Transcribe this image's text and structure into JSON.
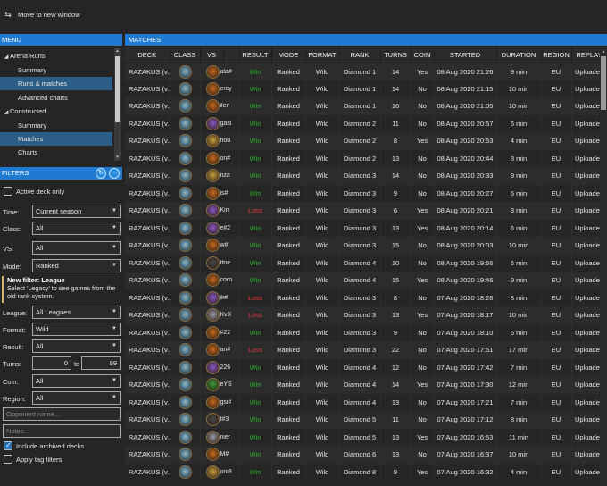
{
  "toolbar": {
    "move_label": "Move to new window",
    "move_icon": "swap-arrows-icon"
  },
  "menu": {
    "header": "MENU",
    "items": [
      {
        "label": "Arena Runs",
        "level": 0,
        "expander": "expanded"
      },
      {
        "label": "Summary",
        "level": 1
      },
      {
        "label": "Runs & matches",
        "level": 1,
        "selected": true
      },
      {
        "label": "Advanced charts",
        "level": 1
      },
      {
        "label": "Constructed",
        "level": 0,
        "expander": "expanded"
      },
      {
        "label": "Summary",
        "level": 1
      },
      {
        "label": "Matches",
        "level": 1,
        "selected": true
      },
      {
        "label": "Charts",
        "level": 1
      }
    ]
  },
  "filters": {
    "header": "FILTERS",
    "refresh_icon": "refresh-icon",
    "more_icon": "more-icon",
    "active_deck_only": {
      "label": "Active deck only",
      "checked": false
    },
    "time": {
      "label": "Time:",
      "value": "Current season"
    },
    "class": {
      "label": "Class:",
      "value": "All"
    },
    "vs": {
      "label": "VS:",
      "value": "All"
    },
    "mode": {
      "label": "Mode:",
      "value": "Ranked"
    },
    "notice": {
      "title": "New filter: League",
      "body": "Select 'Legacy' to see games from the old rank system."
    },
    "league": {
      "label": "League:",
      "value": "All Leagues"
    },
    "format": {
      "label": "Format:",
      "value": "Wild"
    },
    "result": {
      "label": "Result:",
      "value": "All"
    },
    "turns": {
      "label": "Turns:",
      "from": "0",
      "to_label": "to",
      "to": "99"
    },
    "coin": {
      "label": "Coin:",
      "value": "All"
    },
    "region": {
      "label": "Region:",
      "value": "All"
    },
    "opponent_placeholder": "Opponent name...",
    "notes_placeholder": "Notes...",
    "include_archived": {
      "label": "Include archived decks",
      "checked": true
    },
    "apply_tag": {
      "label": "Apply tag filters",
      "checked": false
    }
  },
  "matches": {
    "header": "MATCHES",
    "columns": [
      "DECK",
      "CLASS",
      "VS",
      "",
      "RESULT",
      "MODE",
      "FORMAT",
      "RANK",
      "TURNS",
      "COIN",
      "STARTED",
      "DURATION",
      "REGION",
      "REPLAY"
    ],
    "rows": [
      {
        "deck": "RAZAKUS (v...",
        "vs": "ala#",
        "vs_color": "#c96a1e",
        "result": "Win",
        "mode": "Ranked",
        "format": "Wild",
        "rank": "Diamond 1",
        "turns": "14",
        "coin": "Yes",
        "started": "08 Aug 2020 21:26",
        "duration": "9 min",
        "region": "EU",
        "replay": "Uploaded"
      },
      {
        "deck": "RAZAKUS (v...",
        "vs": "ercy",
        "vs_color": "#c96a1e",
        "result": "Win",
        "mode": "Ranked",
        "format": "Wild",
        "rank": "Diamond 1",
        "turns": "14",
        "coin": "No",
        "started": "08 Aug 2020 21:15",
        "duration": "10 min",
        "region": "EU",
        "replay": "Uploaded"
      },
      {
        "deck": "RAZAKUS (v...",
        "vs": "ilen",
        "vs_color": "#c96a1e",
        "result": "Win",
        "mode": "Ranked",
        "format": "Wild",
        "rank": "Diamond 1",
        "turns": "16",
        "coin": "No",
        "started": "08 Aug 2020 21:05",
        "duration": "10 min",
        "region": "EU",
        "replay": "Uploaded"
      },
      {
        "deck": "RAZAKUS (v...",
        "vs": "gasi",
        "vs_color": "#8a58c8",
        "result": "Win",
        "mode": "Ranked",
        "format": "Wild",
        "rank": "Diamond 2",
        "turns": "11",
        "coin": "No",
        "started": "08 Aug 2020 20:57",
        "duration": "6 min",
        "region": "EU",
        "replay": "Uploaded"
      },
      {
        "deck": "RAZAKUS (v...",
        "vs": "hou",
        "vs_color": "#c8a040",
        "result": "Win",
        "mode": "Ranked",
        "format": "Wild",
        "rank": "Diamond 2",
        "turns": "8",
        "coin": "Yes",
        "started": "08 Aug 2020 20:53",
        "duration": "4 min",
        "region": "EU",
        "replay": "Uploaded"
      },
      {
        "deck": "RAZAKUS (v...",
        "vs": "on#",
        "vs_color": "#c96a1e",
        "result": "Win",
        "mode": "Ranked",
        "format": "Wild",
        "rank": "Diamond 2",
        "turns": "13",
        "coin": "No",
        "started": "08 Aug 2020 20:44",
        "duration": "8 min",
        "region": "EU",
        "replay": "Uploaded"
      },
      {
        "deck": "RAZAKUS (v...",
        "vs": "nza",
        "vs_color": "#c8a040",
        "result": "Win",
        "mode": "Ranked",
        "format": "Wild",
        "rank": "Diamond 3",
        "turns": "14",
        "coin": "No",
        "started": "08 Aug 2020 20:33",
        "duration": "9 min",
        "region": "EU",
        "replay": "Uploaded"
      },
      {
        "deck": "RAZAKUS (v...",
        "vs": "is#",
        "vs_color": "#c96a1e",
        "result": "Win",
        "mode": "Ranked",
        "format": "Wild",
        "rank": "Diamond 3",
        "turns": "9",
        "coin": "No",
        "started": "08 Aug 2020 20:27",
        "duration": "5 min",
        "region": "EU",
        "replay": "Uploaded"
      },
      {
        "deck": "RAZAKUS (v...",
        "vs": "Kin",
        "vs_color": "#8a58c8",
        "result": "Loss",
        "mode": "Ranked",
        "format": "Wild",
        "rank": "Diamond 3",
        "turns": "6",
        "coin": "Yes",
        "started": "08 Aug 2020 20:21",
        "duration": "3 min",
        "region": "EU",
        "replay": "Uploaded"
      },
      {
        "deck": "RAZAKUS (v...",
        "vs": "e#2",
        "vs_color": "#8a58c8",
        "result": "Win",
        "mode": "Ranked",
        "format": "Wild",
        "rank": "Diamond 3",
        "turns": "13",
        "coin": "Yes",
        "started": "08 Aug 2020 20:14",
        "duration": "6 min",
        "region": "EU",
        "replay": "Uploaded"
      },
      {
        "deck": "RAZAKUS (v...",
        "vs": "w#",
        "vs_color": "#c96a1e",
        "result": "Win",
        "mode": "Ranked",
        "format": "Wild",
        "rank": "Diamond 3",
        "turns": "15",
        "coin": "No",
        "started": "08 Aug 2020 20:03",
        "duration": "10 min",
        "region": "EU",
        "replay": "Uploaded"
      },
      {
        "deck": "RAZAKUS (v...",
        "vs": "ttne",
        "vs_color": "#4a4a4a",
        "result": "Win",
        "mode": "Ranked",
        "format": "Wild",
        "rank": "Diamond 4",
        "turns": "10",
        "coin": "No",
        "started": "08 Aug 2020 19:56",
        "duration": "6 min",
        "region": "EU",
        "replay": "Uploaded"
      },
      {
        "deck": "RAZAKUS (v...",
        "vs": "corn",
        "vs_color": "#c96a1e",
        "result": "Win",
        "mode": "Ranked",
        "format": "Wild",
        "rank": "Diamond 4",
        "turns": "15",
        "coin": "Yes",
        "started": "08 Aug 2020 19:46",
        "duration": "9 min",
        "region": "EU",
        "replay": "Uploaded"
      },
      {
        "deck": "RAZAKUS (v...",
        "vs": "ik#",
        "vs_color": "#8a58c8",
        "result": "Loss",
        "mode": "Ranked",
        "format": "Wild",
        "rank": "Diamond 3",
        "turns": "8",
        "coin": "No",
        "started": "07 Aug 2020 18:28",
        "duration": "8 min",
        "region": "EU",
        "replay": "Uploaded"
      },
      {
        "deck": "RAZAKUS (v...",
        "vs": "KvX",
        "vs_color": "#9a9aa8",
        "result": "Loss",
        "mode": "Ranked",
        "format": "Wild",
        "rank": "Diamond 3",
        "turns": "13",
        "coin": "Yes",
        "started": "07 Aug 2020 18:17",
        "duration": "10 min",
        "region": "EU",
        "replay": "Uploaded"
      },
      {
        "deck": "RAZAKUS (v...",
        "vs": "#22",
        "vs_color": "#c96a1e",
        "result": "Win",
        "mode": "Ranked",
        "format": "Wild",
        "rank": "Diamond 3",
        "turns": "9",
        "coin": "No",
        "started": "07 Aug 2020 18:10",
        "duration": "6 min",
        "region": "EU",
        "replay": "Uploaded"
      },
      {
        "deck": "RAZAKUS (v...",
        "vs": "an#",
        "vs_color": "#c96a1e",
        "result": "Loss",
        "mode": "Ranked",
        "format": "Wild",
        "rank": "Diamond 3",
        "turns": "22",
        "coin": "No",
        "started": "07 Aug 2020 17:51",
        "duration": "17 min",
        "region": "EU",
        "replay": "Uploaded"
      },
      {
        "deck": "RAZAKUS (v...",
        "vs": "226",
        "vs_color": "#8a58c8",
        "result": "Win",
        "mode": "Ranked",
        "format": "Wild",
        "rank": "Diamond 4",
        "turns": "12",
        "coin": "No",
        "started": "07 Aug 2020 17:42",
        "duration": "7 min",
        "region": "EU",
        "replay": "Uploaded"
      },
      {
        "deck": "RAZAKUS (v...",
        "vs": "eYS",
        "vs_color": "#3a9a3a",
        "result": "Win",
        "mode": "Ranked",
        "format": "Wild",
        "rank": "Diamond 4",
        "turns": "14",
        "coin": "Yes",
        "started": "07 Aug 2020 17:30",
        "duration": "12 min",
        "region": "EU",
        "replay": "Uploaded"
      },
      {
        "deck": "RAZAKUS (v...",
        "vs": "gsi#",
        "vs_color": "#c96a1e",
        "result": "Win",
        "mode": "Ranked",
        "format": "Wild",
        "rank": "Diamond 4",
        "turns": "13",
        "coin": "No",
        "started": "07 Aug 2020 17:21",
        "duration": "7 min",
        "region": "EU",
        "replay": "Uploaded"
      },
      {
        "deck": "RAZAKUS (v...",
        "vs": "t#3",
        "vs_color": "#4a4a4a",
        "result": "Win",
        "mode": "Ranked",
        "format": "Wild",
        "rank": "Diamond 5",
        "turns": "11",
        "coin": "No",
        "started": "07 Aug 2020 17:12",
        "duration": "8 min",
        "region": "EU",
        "replay": "Uploaded"
      },
      {
        "deck": "RAZAKUS (v...",
        "vs": "nier",
        "vs_color": "#9a9aa8",
        "result": "Win",
        "mode": "Ranked",
        "format": "Wild",
        "rank": "Diamond 5",
        "turns": "13",
        "coin": "Yes",
        "started": "07 Aug 2020 16:53",
        "duration": "11 min",
        "region": "EU",
        "replay": "Uploaded"
      },
      {
        "deck": "RAZAKUS (v...",
        "vs": "M#",
        "vs_color": "#c96a1e",
        "result": "Win",
        "mode": "Ranked",
        "format": "Wild",
        "rank": "Diamond 6",
        "turns": "13",
        "coin": "No",
        "started": "07 Aug 2020 16:37",
        "duration": "10 min",
        "region": "EU",
        "replay": "Uploaded"
      },
      {
        "deck": "RAZAKUS (v...",
        "vs": "oni3",
        "vs_color": "#c8a040",
        "result": "Win",
        "mode": "Ranked",
        "format": "Wild",
        "rank": "Diamond 8",
        "turns": "9",
        "coin": "Yes",
        "started": "07 Aug 2020 16:32",
        "duration": "4 min",
        "region": "EU",
        "replay": "Uploaded"
      }
    ]
  },
  "colors": {
    "accent": "#1e7bd1",
    "win": "#2bb02b",
    "loss": "#e03a3a",
    "selected": "#2b5d86"
  }
}
